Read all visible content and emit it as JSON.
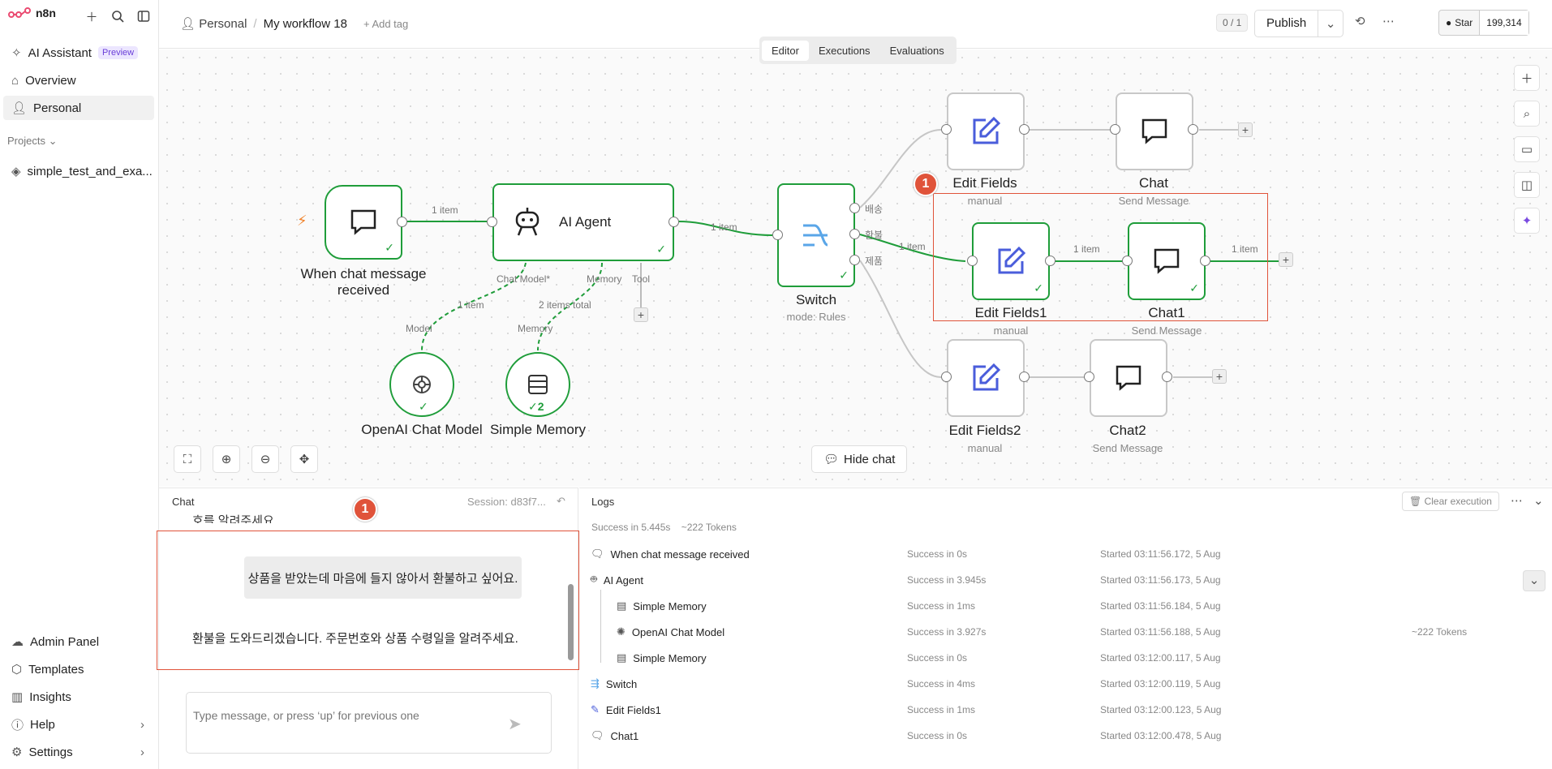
{
  "sidebar": {
    "brand": "n8n",
    "items": [
      {
        "label": "AI Assistant",
        "badge": "Preview"
      },
      {
        "label": "Overview"
      },
      {
        "label": "Personal"
      }
    ],
    "projects_label": "Projects",
    "project": "simple_test_and_exa...",
    "bottom": [
      "Admin Panel",
      "Templates",
      "Insights",
      "Help",
      "Settings"
    ]
  },
  "header": {
    "owner": "Personal",
    "title": "My workflow 18",
    "add_tag": "+ Add tag",
    "counter": "0 / 1",
    "publish": "Publish",
    "star": "Star",
    "stars": "199,314"
  },
  "tabs": [
    "Editor",
    "Executions",
    "Evaluations"
  ],
  "nodes": {
    "trigger": {
      "label": "When chat message received"
    },
    "agent": {
      "label": "AI Agent",
      "chat_model": "Chat Model*",
      "memory": "Memory",
      "tool": "Tool"
    },
    "openai": {
      "label": "OpenAI Chat Model",
      "port": "Model"
    },
    "memory": {
      "label": "Simple Memory",
      "port": "Memory",
      "count": "2"
    },
    "switch": {
      "label": "Switch",
      "sub": "mode: Rules",
      "out1": "배송",
      "out2": "환불",
      "out3": "제품"
    },
    "ef": {
      "label": "Edit Fields",
      "sub": "manual"
    },
    "chat": {
      "label": "Chat",
      "sub": "Send Message"
    },
    "ef1": {
      "label": "Edit Fields1",
      "sub": "manual"
    },
    "chat1": {
      "label": "Chat1",
      "sub": "Send Message"
    },
    "ef2": {
      "label": "Edit Fields2",
      "sub": "manual"
    },
    "chat2": {
      "label": "Chat2",
      "sub": "Send Message"
    }
  },
  "edges": {
    "e1": "1 item",
    "e2": "1 item",
    "e3": "1 item",
    "e4": "1 item",
    "e5": "1 item",
    "e6": "1 item",
    "e7": "2 items total"
  },
  "annotations": {
    "badge": "1"
  },
  "canvas": {
    "hide_chat": "Hide chat"
  },
  "chat": {
    "title": "Chat",
    "session": "Session: d83f7...",
    "partial": "호를 알려주세요.",
    "user_msg": "상품을 받았는데 마음에 들지 않아서 환불하고 싶어요.",
    "bot_msg": "환불을 도와드리겠습니다. 주문번호와 상품 수령일을 알려주세요.",
    "placeholder": "Type message, or press ‘up’ for previous one"
  },
  "logs": {
    "title": "Logs",
    "clear": "Clear execution",
    "summary": "Success in 5.445s",
    "tokens": "~222 Tokens",
    "rows": [
      {
        "name": "When chat message received",
        "status": "Success in 0s",
        "started": "Started 03:11:56.172, 5 Aug",
        "tok": ""
      },
      {
        "name": "AI Agent",
        "status": "Success in 3.945s",
        "started": "Started 03:11:56.173, 5 Aug",
        "tok": ""
      },
      {
        "name": "Simple Memory",
        "status": "Success in 1ms",
        "started": "Started 03:11:56.184, 5 Aug",
        "tok": ""
      },
      {
        "name": "OpenAI Chat Model",
        "status": "Success in 3.927s",
        "started": "Started 03:11:56.188, 5 Aug",
        "tok": "~222 Tokens"
      },
      {
        "name": "Simple Memory",
        "status": "Success in 0s",
        "started": "Started 03:12:00.117, 5 Aug",
        "tok": ""
      },
      {
        "name": "Switch",
        "status": "Success in 4ms",
        "started": "Started 03:12:00.119, 5 Aug",
        "tok": ""
      },
      {
        "name": "Edit Fields1",
        "status": "Success in 1ms",
        "started": "Started 03:12:00.123, 5 Aug",
        "tok": ""
      },
      {
        "name": "Chat1",
        "status": "Success in 0s",
        "started": "Started 03:12:00.478, 5 Aug",
        "tok": ""
      }
    ]
  }
}
